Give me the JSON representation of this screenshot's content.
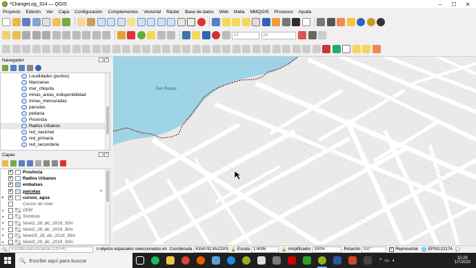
{
  "window": {
    "title": "*ChangeLog_314 — QGIS",
    "controls": [
      "–",
      "☐",
      "✕"
    ]
  },
  "menu": [
    "Proyecto",
    "Edición",
    "Ver",
    "Capa",
    "Configuración",
    "Complementos",
    "Vectorial",
    "Ráster",
    "Base de datos",
    "Web",
    "Malla",
    "MMQGIS",
    "Procesos",
    "Ayuda"
  ],
  "toolbar": {
    "font_size": "12",
    "font_unit": "px"
  },
  "browser_panel": {
    "title": "Navegador",
    "items": [
      {
        "label": "Localidades (puntos)",
        "selected": false
      },
      {
        "label": "Manzanas",
        "selected": false
      },
      {
        "label": "mar_chiquita",
        "selected": false
      },
      {
        "label": "minas_areas_indisponibilidad",
        "selected": false
      },
      {
        "label": "minas_mensuradas",
        "selected": false
      },
      {
        "label": "parcelas",
        "selected": false
      },
      {
        "label": "pedania",
        "selected": false
      },
      {
        "label": "Provincia",
        "selected": false
      },
      {
        "label": "Radios Urbanos",
        "selected": true
      },
      {
        "label": "red_nacional",
        "selected": false
      },
      {
        "label": "red_primaria",
        "selected": false
      },
      {
        "label": "red_secundaria",
        "selected": false
      }
    ]
  },
  "layers_panel": {
    "title": "Capas",
    "items": [
      {
        "label": "Provincia",
        "checked": true,
        "style": "bold",
        "swatch": "#ffffff"
      },
      {
        "label": "Radios Urbanos",
        "checked": true,
        "style": "bold",
        "swatch": "#ffffff"
      },
      {
        "label": "embalses",
        "checked": true,
        "style": "bold",
        "swatch": "#a6cee3"
      },
      {
        "label": "parcelas",
        "checked": true,
        "style": "bold-underline",
        "swatch": "#cfe6f7"
      },
      {
        "label": "cursos_agua",
        "checked": true,
        "style": "bold",
        "swatch": "#ffffff"
      },
      {
        "label": "Cursos de nivel",
        "checked": false,
        "style": "italic",
        "swatch": ""
      },
      {
        "label": "DEM",
        "checked": false,
        "style": "italic",
        "swatch": "raster"
      },
      {
        "label": "Sombras",
        "checked": false,
        "style": "italic",
        "swatch": "raster"
      },
      {
        "label": "Nivel1_28_dic_2018_30m",
        "checked": false,
        "style": "italic",
        "swatch": "raster"
      },
      {
        "label": "Nivel2_28_dic_2018_30m",
        "checked": false,
        "style": "italic",
        "swatch": "raster"
      },
      {
        "label": "Nivel25_28_dic_2018_30m",
        "checked": false,
        "style": "italic",
        "swatch": "raster"
      },
      {
        "label": "Nivel3_28_dic_2018_30m",
        "checked": false,
        "style": "italic",
        "swatch": "raster"
      }
    ]
  },
  "map": {
    "label": "San Roque",
    "water_color": "#9fd3e6",
    "background_color": "#eaeaea",
    "street_color": "#ffffff",
    "boundary_color": "#8b1a1a"
  },
  "statusbar": {
    "locate_placeholder": "Escriba para localizar (Ctrl+K)",
    "selected_msg": "0 objetos espaciales seleccionados en la c",
    "coord_label": "Coordenada",
    "coord_value": "4358782,6523306",
    "scale_label": "Escala",
    "scale_value": "1:4006",
    "magnifier_label": "Amplificador",
    "magnifier_value": "100%",
    "rotation_label": "Rotación",
    "rotation_value": "0,0 °",
    "render_label": "Representar",
    "crs": "EPSG:22174"
  },
  "taskbar": {
    "search_placeholder": "Escribe aquí para buscar",
    "time": "15:26",
    "date": "1/7/2020"
  }
}
